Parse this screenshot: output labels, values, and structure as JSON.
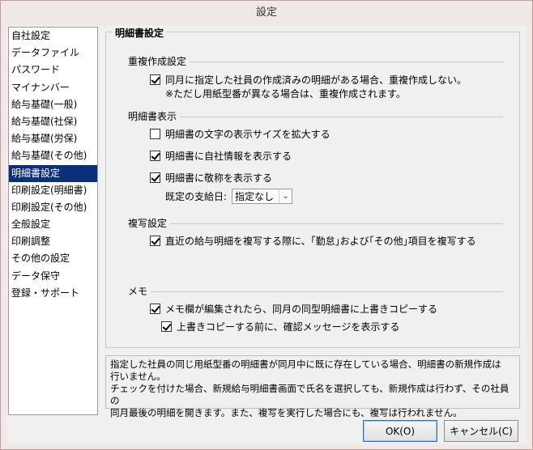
{
  "window": {
    "title": "設定"
  },
  "sidebar": {
    "items": [
      {
        "label": "自社設定"
      },
      {
        "label": "データファイル"
      },
      {
        "label": "パスワード"
      },
      {
        "label": "マイナンバー"
      },
      {
        "label": "給与基礎(一般)"
      },
      {
        "label": "給与基礎(社保)"
      },
      {
        "label": "給与基礎(労保)"
      },
      {
        "label": "給与基礎(その他)"
      },
      {
        "label": "明細書設定"
      },
      {
        "label": "印刷設定(明細書)"
      },
      {
        "label": "印刷設定(その他)"
      },
      {
        "label": "全般設定"
      },
      {
        "label": "印刷調整"
      },
      {
        "label": "その他の設定"
      },
      {
        "label": "データ保守"
      },
      {
        "label": "登録・サポート"
      }
    ],
    "selected": "明細書設定"
  },
  "panel": {
    "title": "明細書設定",
    "duplicate": {
      "heading": "重複作成設定",
      "check_label": "同月に指定した社員の作成済みの明細がある場合、重複作成しない。",
      "checked": true,
      "note": "※ただし用紙型番が異なる場合は、重複作成されます。"
    },
    "display": {
      "heading": "明細書表示",
      "enlarge_label": "明細書の文字の表示サイズを拡大する",
      "enlarge_checked": false,
      "company_label": "明細書に自社情報を表示する",
      "company_checked": true,
      "honorific_label": "明細書に敬称を表示する",
      "honorific_checked": true,
      "payday_label": "既定の支給日:",
      "payday_value": "指定なし"
    },
    "copy": {
      "heading": "複写設定",
      "check_label": "直近の給与明細を複写する際に、｢勤怠｣および｢その他｣項目を複写する",
      "checked": true
    },
    "memo": {
      "heading": "メモ",
      "overwrite_label": "メモ欄が編集されたら、同月の同型明細書に上書きコピーする",
      "overwrite_checked": true,
      "confirm_label": "上書きコピーする前に、確認メッセージを表示する",
      "confirm_checked": true
    }
  },
  "description": {
    "line1": "指定した社員の同じ用紙型番の明細書が同月中に既に存在している場合、明細書の新規作成は",
    "line2": "行いません。",
    "line3": "チェックを付けた場合、新規給与明細書画面で氏名を選択しても、新規作成は行わず、その社員の",
    "line4": "同月最後の明細を開きます。また、複写を実行した場合にも、複写は行われません。"
  },
  "buttons": {
    "ok": "OK(O)",
    "cancel": "キャンセル(C)"
  }
}
